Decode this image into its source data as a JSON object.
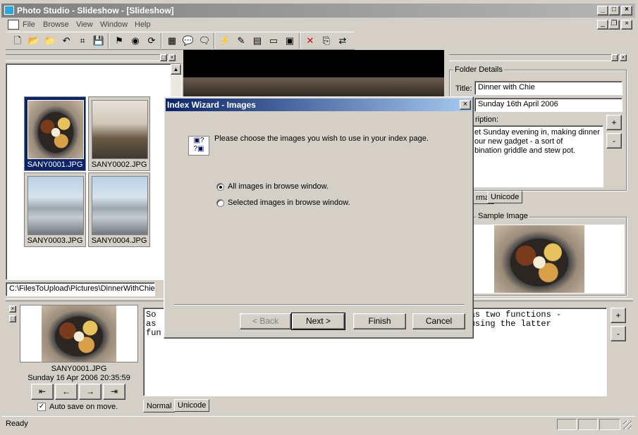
{
  "app": {
    "title": "Photo Studio - Slideshow - [Slideshow]",
    "window_buttons": [
      "_",
      "□",
      "×"
    ]
  },
  "menu": [
    "File",
    "Browse",
    "View",
    "Window",
    "Help"
  ],
  "toolbar": {
    "icons": [
      "new-icon",
      "open-icon",
      "open-folder-icon",
      "undo-icon",
      "scan-icon",
      "save-icon",
      "sign-icon",
      "globe-icon",
      "refresh-icon",
      "grid-icon",
      "comment-icon",
      "comments-icon",
      "wand-icon",
      "html-wand-icon",
      "table-icon",
      "slideshow-icon",
      "present-icon",
      "delete-icon",
      "copy-icon",
      "move-icon"
    ]
  },
  "browser": {
    "thumbnails": [
      {
        "name": "SANY0001.JPG",
        "selected": true,
        "kind": "food"
      },
      {
        "name": "SANY0002.JPG",
        "selected": false,
        "kind": "room"
      },
      {
        "name": "SANY0003.JPG",
        "selected": false,
        "kind": "balcony"
      },
      {
        "name": "SANY0004.JPG",
        "selected": false,
        "kind": "balcony"
      }
    ],
    "path": "C:\\FilesToUpload\\Pictures\\DinnerWithChie"
  },
  "folder_details": {
    "group_label": "Folder Details",
    "title_label": "Title:",
    "title_value": "Dinner with Chie",
    "date_value": "Sunday 16th April 2006",
    "description_label": "ription:",
    "description_lines": [
      "et Sunday evening in, making dinner",
      "our new gadget - a sort of",
      "bination griddle and stew pot."
    ],
    "tabs": [
      "rmal",
      "Unicode"
    ],
    "plus": "+",
    "minus": "-"
  },
  "sample_image": {
    "label": "Sample Image"
  },
  "preview": {
    "filename": "SANY0001.JPG",
    "datetime": "Sunday 16 Apr 2006 20:35:59",
    "nav_buttons": [
      "first",
      "prev",
      "next",
      "last"
    ],
    "autosave_label": "Auto save on move.",
    "autosave_checked": true
  },
  "caption": {
    "left_lines": [
      "So",
      "as",
      "fun"
    ],
    "right_lines": [
      "t has two functions -",
      "re using the latter"
    ],
    "tabs": [
      "Normal",
      "Unicode"
    ],
    "plus": "+",
    "minus": "-"
  },
  "status": {
    "text": "Ready"
  },
  "dialog": {
    "title": "Index Wizard - Images",
    "close": "×",
    "prompt": "Please choose the images you wish to use in your index page.",
    "options": [
      {
        "label": "All images in browse window.",
        "selected": true
      },
      {
        "label": "Selected images in browse window.",
        "selected": false
      }
    ],
    "buttons": {
      "back": "< Back",
      "next": "Next >",
      "finish": "Finish",
      "cancel": "Cancel"
    }
  }
}
